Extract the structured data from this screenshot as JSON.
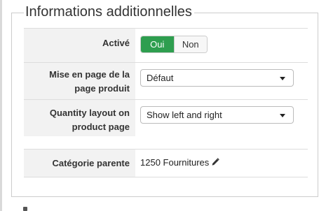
{
  "fieldset": {
    "legend": "Informations additionnelles"
  },
  "rows": {
    "active": {
      "label": "Activé",
      "yes_label": "Oui",
      "no_label": "Non",
      "selected": "Oui",
      "selected_color": "#2e9e4f"
    },
    "product_layout": {
      "label_line1": "Mise en page de la",
      "label_line2": "page produit",
      "value": "Défaut"
    },
    "quantity_layout": {
      "label_line1": "Quantity layout on",
      "label_line2": "product page",
      "value": "Show left and right"
    },
    "parent_category": {
      "label": "Catégorie parente",
      "value": "1250 Fournitures",
      "edit_icon": "pencil-icon"
    }
  }
}
